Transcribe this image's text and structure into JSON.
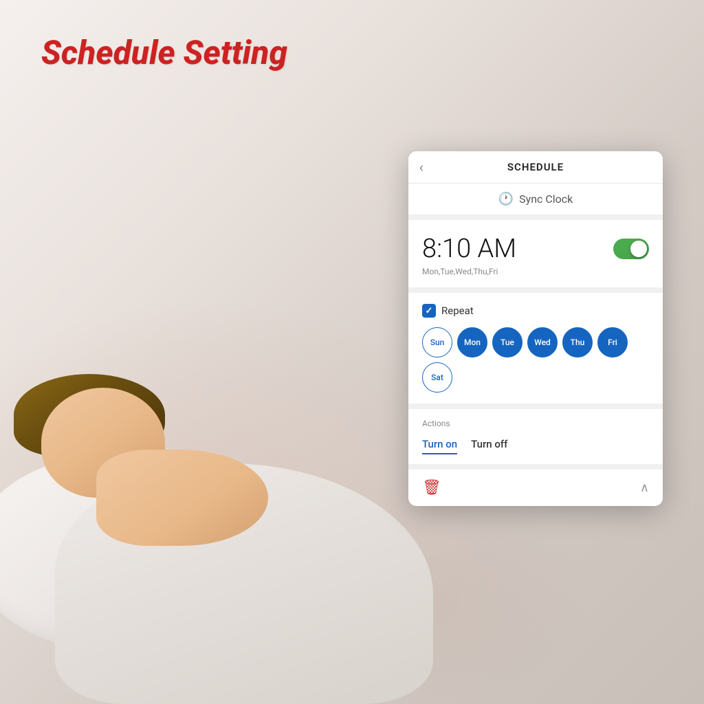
{
  "page": {
    "title": "Schedule Setting"
  },
  "header": {
    "back_label": "‹",
    "title": "SCHEDULE"
  },
  "sync_clock": {
    "icon": "🕐",
    "label": "Sync Clock"
  },
  "schedule": {
    "time": "8:10 AM",
    "toggle_on": true,
    "days_summary": "Mon,Tue,Wed,Thu,Fri"
  },
  "repeat": {
    "label": "Repeat",
    "checked": true,
    "days": [
      {
        "label": "Sun",
        "active": false
      },
      {
        "label": "Mon",
        "active": true
      },
      {
        "label": "Tue",
        "active": true
      },
      {
        "label": "Wed",
        "active": true
      },
      {
        "label": "Thu",
        "active": true
      },
      {
        "label": "Fri",
        "active": true
      },
      {
        "label": "Sat",
        "active": false
      }
    ]
  },
  "actions": {
    "label": "Actions",
    "turn_on": "Turn on",
    "turn_off": "Turn off"
  },
  "colors": {
    "title_red": "#cc2222",
    "primary_blue": "#1565C0",
    "toggle_green": "#4CAF50",
    "trash_red": "#cc3333"
  }
}
